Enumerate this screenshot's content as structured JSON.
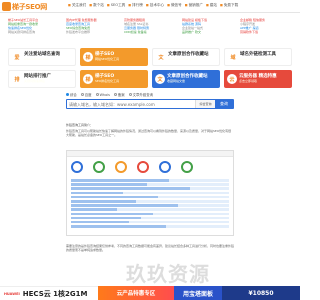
{
  "nav": {
    "logo_text": "梯子SEO网",
    "items": [
      "关注我们",
      "数个站",
      "SEO工具",
      "排行榜",
      "技术中心",
      "微信号",
      "营销推广",
      "建站",
      "免费下载"
    ]
  },
  "text_links": {
    "col1": [
      "梯子SEO站长工具平台",
      "网站权重查询一键收录",
      "快速排名SEO优化",
      "网站关键词排名查询"
    ],
    "col2": [
      "国内IP代理 免费服务器",
      "百度收录查询工具",
      "SEO综合查询免费",
      "外链发布平台推荐"
    ],
    "col3": [
      "高防服务器租用",
      "域名注册 SSL证书",
      "云服务器 限时特惠",
      "CDN加速 免备案"
    ],
    "col4": [
      "网站建设 模板下载",
      "站群系统 源码",
      "企业建站一站式",
      "品牌推广 软文"
    ],
    "col5": [
      "企业邮箱 短信服务",
      "小程序开发",
      "APP推广 渠道",
      "营销软件下载"
    ]
  },
  "banners": [
    {
      "title": "关注爱站域名查询",
      "sub": "www.aizhan.com",
      "style": "b-white",
      "badge": "爱"
    },
    {
      "title": "梯子SEO",
      "sub": "网站SEO优化工具",
      "style": "b-orange",
      "badge": "梯"
    },
    {
      "title": "文章原创合作收藏站",
      "sub": "www.wenzhang.net",
      "style": "b-white",
      "badge": "文"
    },
    {
      "title": "域名外链检测工具",
      "sub": "www.linkcheck.com",
      "style": "b-white",
      "badge": "域"
    },
    {
      "title": "网站排行推广",
      "sub": "关键词快速排名",
      "style": "b-white",
      "badge": "排"
    },
    {
      "title": "梯子SEO",
      "sub": "SEO排名优化工具",
      "style": "b-orange",
      "badge": "梯"
    },
    {
      "title": "文章原创合作收藏站",
      "sub": "收藏网站文章",
      "style": "b-blue",
      "badge": "文"
    },
    {
      "title": "云服务器 精选特惠",
      "sub": "点击立即领取",
      "style": "b-red",
      "badge": "云"
    }
  ],
  "search": {
    "tabs": [
      {
        "label": "综合",
        "active": true
      },
      {
        "label": "百度",
        "active": false
      },
      {
        "label": "Whois",
        "active": false
      },
      {
        "label": "备案",
        "active": false
      },
      {
        "label": "文章外链查询",
        "active": false
      }
    ],
    "placeholder": "请输入域名，输入域名如：www.example.com",
    "select_label": "综合查询",
    "button_label": "查询"
  },
  "article": {
    "heading": "外链查询工具简介：",
    "p1": "外链查询工具可以帮助站长快速了解网站的外链情况，通过查询可以看到外链的数量、来源以及质量，对于网站SEO优化有很大帮助，是站长必备的SEO工具之一。",
    "p2": "使用方法：在上方输入框中输入需要查询的域名，点击查询按钮即可。",
    "p3": "需要注意的是外链查询结果仅供参考，不同的查询工具数据可能会有差异，建议站长结合多种工具进行分析，同时也要注重外链的质量而不是单纯追求数量。"
  },
  "watermark": "玖玖资源",
  "ads": {
    "ad1_brand": "HUAWEI",
    "ad1_text": "HECS云 1核2G1M",
    "ad2_text": "云产品特惠专区",
    "ad3_text": "用宝塔面板",
    "ad4_text": "¥10850"
  }
}
